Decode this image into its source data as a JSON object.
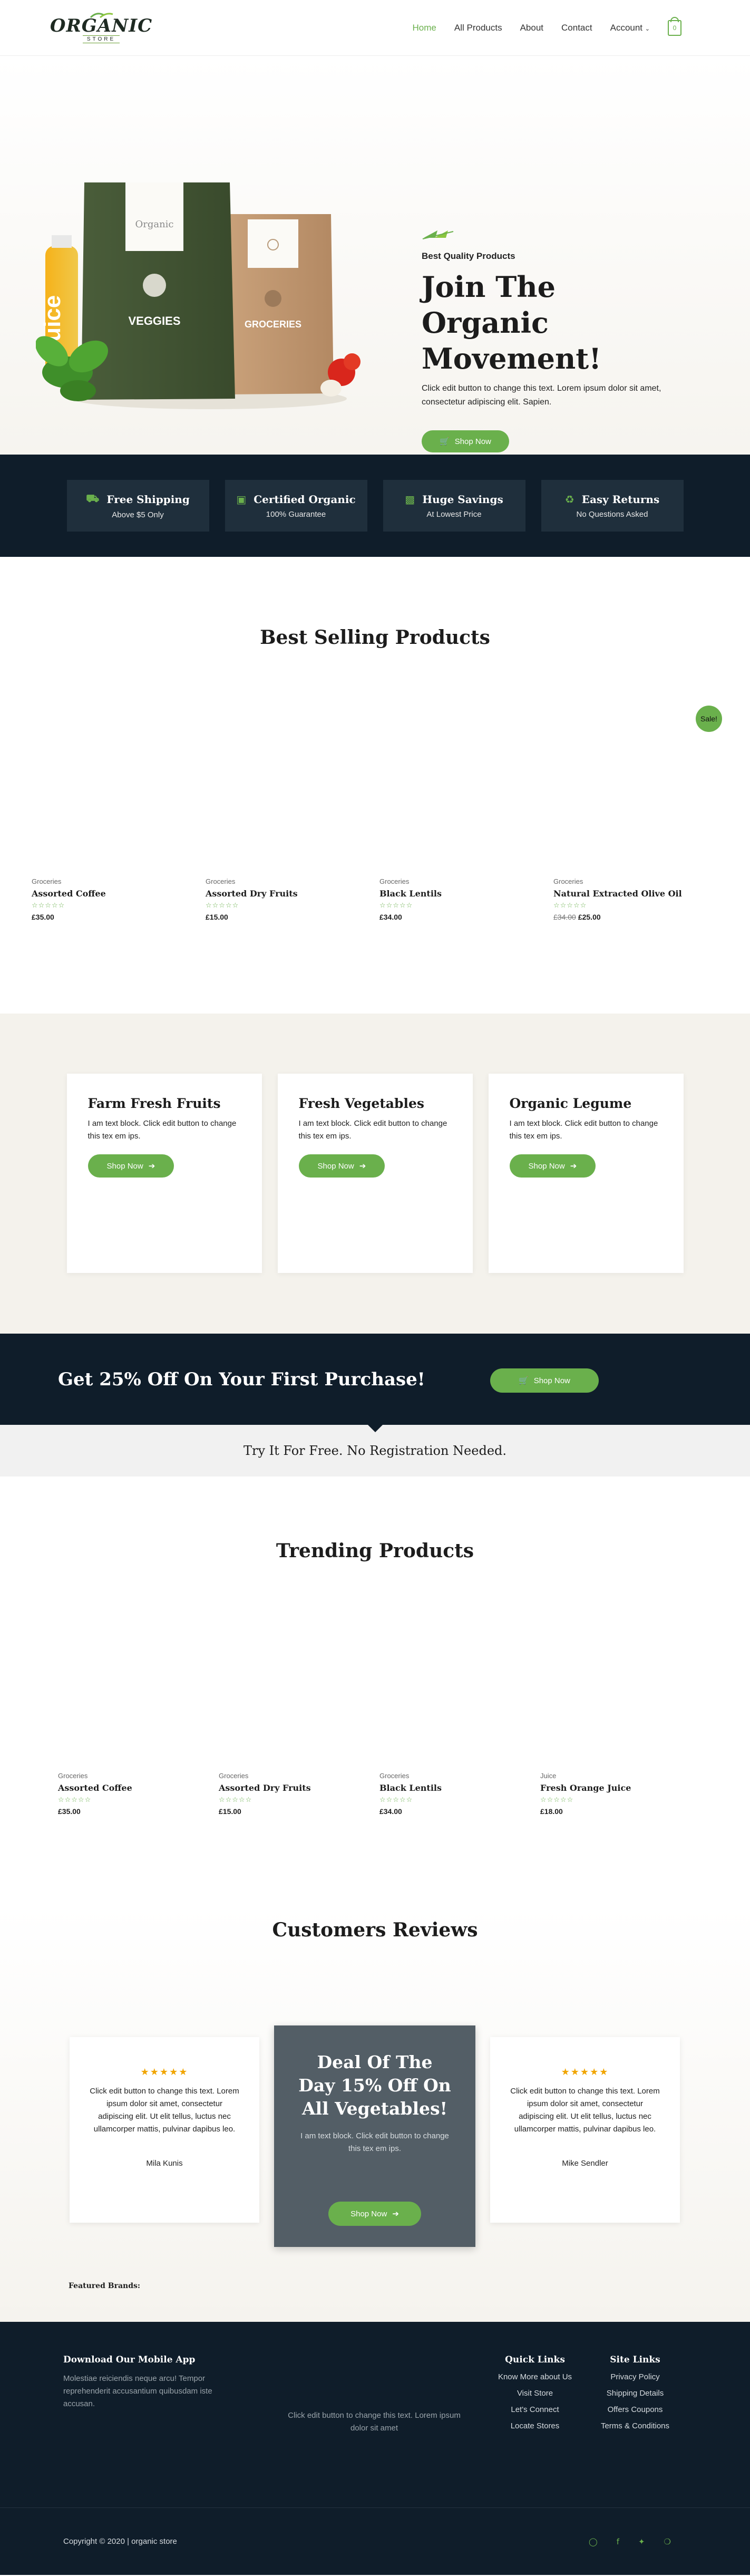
{
  "header": {
    "logo_text": "ORGANIC",
    "logo_sub": "STORE",
    "nav": [
      {
        "label": "Home"
      },
      {
        "label": "All Products"
      },
      {
        "label": "About"
      },
      {
        "label": "Contact"
      },
      {
        "label": "Account"
      }
    ],
    "cart_count": "0"
  },
  "hero": {
    "eyebrow": "Best Quality Products",
    "title": "Join The Organic Movement!",
    "description": "Click edit button to change this text. Lorem ipsum dolor sit amet, consectetur adipiscing elit. Sapien.",
    "button": "Shop Now",
    "bag_left_label": "VEGGIES",
    "bag_right_label": "GROCERIES",
    "bag_brand": "Organic",
    "bottle_label": "Juice"
  },
  "features": [
    {
      "title": "Free Shipping",
      "subtitle": "Above $5 Only",
      "icon": "truck-icon"
    },
    {
      "title": "Certified Organic",
      "subtitle": "100% Guarantee",
      "icon": "certificate-icon"
    },
    {
      "title": "Huge Savings",
      "subtitle": "At Lowest Price",
      "icon": "money-icon"
    },
    {
      "title": "Easy Returns",
      "subtitle": "No Questions Asked",
      "icon": "recycle-icon"
    }
  ],
  "best_selling": {
    "title": "Best Selling Products",
    "sale_badge": "Sale!",
    "products": [
      {
        "category": "Groceries",
        "name": "Assorted Coffee",
        "price": "£35.00",
        "old_price": ""
      },
      {
        "category": "Groceries",
        "name": "Assorted Dry Fruits",
        "price": "£15.00",
        "old_price": ""
      },
      {
        "category": "Groceries",
        "name": "Black Lentils",
        "price": "£34.00",
        "old_price": ""
      },
      {
        "category": "Groceries",
        "name": "Natural Extracted Olive Oil",
        "price": "£25.00",
        "old_price": "£34.00"
      }
    ]
  },
  "categories": [
    {
      "title": "Farm Fresh Fruits",
      "description": "I am text block. Click edit button to change this tex em ips.",
      "button": "Shop Now"
    },
    {
      "title": "Fresh Vegetables",
      "description": "I am text block. Click edit button to change this tex em ips.",
      "button": "Shop Now"
    },
    {
      "title": "Organic Legume",
      "description": "I am text block. Click edit button to change this tex em ips.",
      "button": "Shop Now"
    }
  ],
  "promo": {
    "text": "Get 25% Off On Your First Purchase!",
    "button": "Shop Now",
    "subtext": "Try It For Free. No Registration Needed."
  },
  "trending": {
    "title": "Trending Products",
    "products": [
      {
        "category": "Groceries",
        "name": "Assorted Coffee",
        "price": "£35.00"
      },
      {
        "category": "Groceries",
        "name": "Assorted Dry Fruits",
        "price": "£15.00"
      },
      {
        "category": "Groceries",
        "name": "Black Lentils",
        "price": "£34.00"
      },
      {
        "category": "Juice",
        "name": "Fresh Orange Juice",
        "price": "£18.00"
      }
    ]
  },
  "reviews": {
    "title": "Customers Reviews",
    "items": [
      {
        "stars": "★★★★★",
        "text": "Click edit button to change this text. Lorem ipsum dolor sit amet, consectetur adipiscing elit. Ut elit tellus, luctus nec ullamcorper mattis, pulvinar dapibus leo.",
        "name": "Mila Kunis"
      },
      {
        "stars": "★★★★★",
        "text": "Click edit button to change this text. Lorem ipsum dolor sit amet, consectetur adipiscing elit. Ut elit tellus, luctus nec ullamcorper mattis, pulvinar dapibus leo.",
        "name": "Mike Sendler"
      }
    ],
    "deal": {
      "title": "Deal Of The Day 15% Off On All Vegetables!",
      "description": "I am text block. Click edit button to change this tex em ips.",
      "button": "Shop Now"
    },
    "brands_label": "Featured Brands:"
  },
  "footer": {
    "app_title": "Download Our Mobile App",
    "app_desc": "Molestiae reiciendis neque arcu! Tempor reprehenderit accusantium quibusdam iste accusan.",
    "mid_text": "Click edit button to change this text. Lorem ipsum dolor sit amet",
    "quick_links": {
      "title": "Quick Links",
      "items": [
        "Know More about Us",
        "Visit Store",
        "Let's Connect",
        "Locate Stores"
      ]
    },
    "site_links": {
      "title": "Site Links",
      "items": [
        "Privacy Policy",
        "Shipping Details",
        "Offers Coupons",
        "Terms & Conditions"
      ]
    },
    "copyright": "Copyright © 2020 | organic store",
    "socials": [
      "instagram-icon",
      "facebook-icon",
      "twitter-icon",
      "pinterest-icon"
    ]
  },
  "colors": {
    "accent": "#6ab04c",
    "dark": "#0f1d2a",
    "card_dark": "#1f2f3c",
    "deal_bg": "#535e66",
    "star": "#f0a500"
  }
}
